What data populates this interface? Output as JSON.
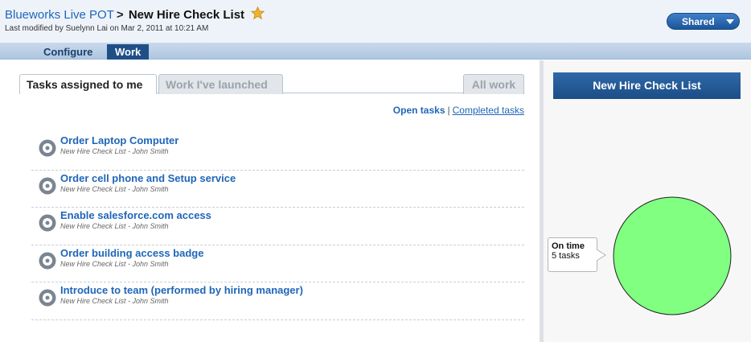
{
  "header": {
    "space_link": "Blueworks Live POT",
    "separator": ">",
    "title": "New Hire Check List",
    "modified": "Last modified by Suelynn Lai on Mar 2, 2011 at 10:21 AM",
    "shared_label": "Shared",
    "star_icon": "favorite-star-icon",
    "star_color": "#f0b429"
  },
  "nav": {
    "configure": "Configure",
    "work": "Work"
  },
  "tabs": {
    "assigned": "Tasks assigned to me",
    "launched": "Work I've launched",
    "all": "All work"
  },
  "filter": {
    "open": "Open tasks",
    "pipe": "|",
    "completed": "Completed tasks"
  },
  "tasks": [
    {
      "title": "Order Laptop Computer",
      "subtitle": "New Hire Check List - John Smith"
    },
    {
      "title": "Order cell phone and Setup service",
      "subtitle": "New Hire Check List - John Smith"
    },
    {
      "title": "Enable salesforce.com access",
      "subtitle": "New Hire Check List - John Smith"
    },
    {
      "title": "Order building access badge",
      "subtitle": "New Hire Check List - John Smith"
    },
    {
      "title": "Introduce to team (performed by hiring manager)",
      "subtitle": "New Hire Check List - John Smith"
    }
  ],
  "task_icon": "task-gear-icon",
  "side": {
    "title": "New Hire Check List",
    "tooltip_status": "On time",
    "tooltip_count": "5 tasks"
  },
  "colors": {
    "accent": "#1f4f87",
    "link": "#1f66b8",
    "pie_on_time": "#80ff80"
  },
  "chart_data": {
    "type": "pie",
    "categories": [
      "On time"
    ],
    "values": [
      5
    ],
    "colors": [
      "#80ff80"
    ]
  }
}
